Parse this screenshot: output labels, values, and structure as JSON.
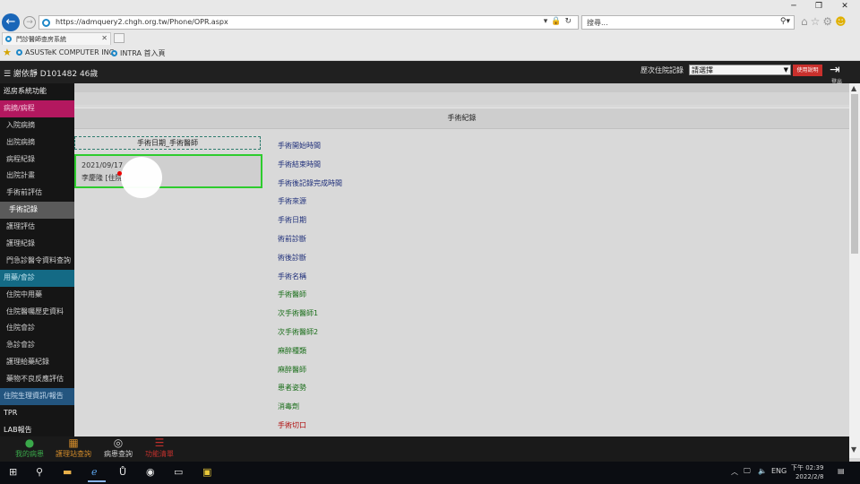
{
  "browser": {
    "url": "https://admquery2.chgh.org.tw/Phone/OPR.aspx",
    "search_placeholder": "搜尋...",
    "tab_title": "門診醫師查房系統",
    "favorites": [
      "ASUSTeK COMPUTER INC",
      "INTRA 首入頁"
    ]
  },
  "header": {
    "patient": "☰ 謝依靜 D101482 46歲",
    "history_label": "歷次住院記錄",
    "history_select": "請選擇",
    "help_button": "使用說明",
    "logout_label": "登出"
  },
  "sidebar": {
    "items": [
      {
        "label": "巡房系統功能",
        "kind": "sect"
      },
      {
        "label": "病摘/病程",
        "kind": "sect-pink"
      },
      {
        "label": "入院病摘",
        "kind": "item"
      },
      {
        "label": "出院病摘",
        "kind": "item"
      },
      {
        "label": "病程紀錄",
        "kind": "item"
      },
      {
        "label": "出院計畫",
        "kind": "item"
      },
      {
        "label": "手術前評估",
        "kind": "item"
      },
      {
        "label": "手術記錄",
        "kind": "active"
      },
      {
        "label": "護理評估",
        "kind": "item"
      },
      {
        "label": "護理紀錄",
        "kind": "item"
      },
      {
        "label": "門急診醫令資料查詢",
        "kind": "item"
      },
      {
        "label": "用藥/會診",
        "kind": "sect-teal"
      },
      {
        "label": "住院中用藥",
        "kind": "item"
      },
      {
        "label": "住院醫囑歷史資料",
        "kind": "item"
      },
      {
        "label": "住院會診",
        "kind": "item"
      },
      {
        "label": "急診會診",
        "kind": "item"
      },
      {
        "label": "護理給藥紀錄",
        "kind": "item"
      },
      {
        "label": "藥物不良反應評估",
        "kind": "item"
      },
      {
        "label": "住院生理資訊/報告",
        "kind": "sect-blue"
      },
      {
        "label": "TPR",
        "kind": "sect"
      },
      {
        "label": "LAB報告",
        "kind": "sect"
      }
    ]
  },
  "main": {
    "section_title": "手術紀錄",
    "list_header": "手術日期_手術醫師",
    "record": {
      "date": "2021/09/17",
      "doctor": "李慶隆 [住院]"
    },
    "fields": [
      {
        "label": "手術開始時間",
        "color": "#1f2f7a"
      },
      {
        "label": "手術結束時間",
        "color": "#1f2f7a"
      },
      {
        "label": "手術後記錄完成時間",
        "color": "#1f2f7a"
      },
      {
        "label": "手術來源",
        "color": "#1f2f7a"
      },
      {
        "label": "手術日期",
        "color": "#1f2f7a"
      },
      {
        "label": "術前診斷",
        "color": "#1f2f7a"
      },
      {
        "label": "術後診斷",
        "color": "#1f2f7a"
      },
      {
        "label": "手術名稱",
        "color": "#1f2f7a"
      },
      {
        "label": "手術醫師",
        "color": "#1a6e1a"
      },
      {
        "label": "次手術醫師1",
        "color": "#1a6e1a"
      },
      {
        "label": "次手術醫師2",
        "color": "#1a6e1a"
      },
      {
        "label": "麻醉種類",
        "color": "#1a6e1a"
      },
      {
        "label": "麻醉醫師",
        "color": "#1a6e1a"
      },
      {
        "label": "患者姿勢",
        "color": "#1a6e1a"
      },
      {
        "label": "消毒劑",
        "color": "#1a6e1a"
      },
      {
        "label": "手術切口",
        "color": "#b01010"
      }
    ]
  },
  "bottom_nav": [
    {
      "label": "我的病患",
      "icon": "person-icon",
      "glyph": "●",
      "color": "#3aa84a"
    },
    {
      "label": "護理站查詢",
      "icon": "calendar-icon",
      "glyph": "▦",
      "color": "#d08a2a"
    },
    {
      "label": "病患查詢",
      "icon": "search-icon",
      "glyph": "◎",
      "color": "#cfcfcf"
    },
    {
      "label": "功能清單",
      "icon": "list-icon",
      "glyph": "☰",
      "color": "#c0302c"
    }
  ],
  "taskbar": {
    "language": "ENG",
    "time": "下午 02:39",
    "date": "2022/2/8"
  }
}
